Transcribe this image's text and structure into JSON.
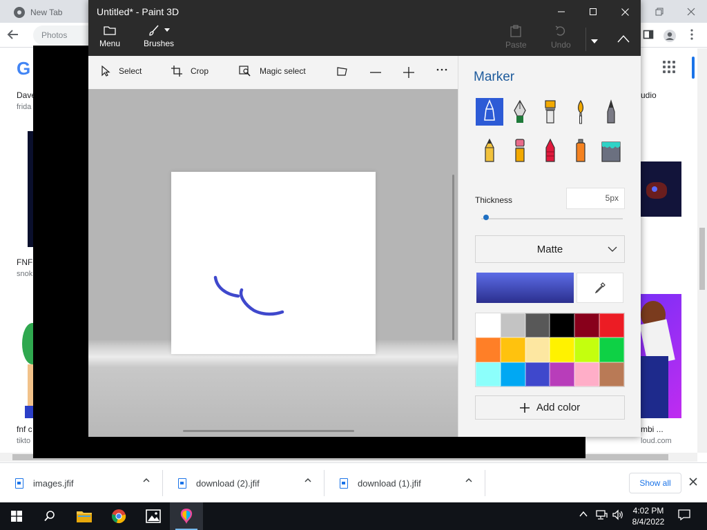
{
  "chrome": {
    "tab_title": "New Tab",
    "omnibox_text": "Photos",
    "logo_letter": "G",
    "results": {
      "left_col": [
        "Dave",
        "frida",
        "FNF",
        "snok",
        "fnf c",
        "tikto"
      ],
      "right_col": [
        "udio",
        "mbi ...",
        "loud.com"
      ]
    }
  },
  "downloads": {
    "items": [
      {
        "name": "images.jfif"
      },
      {
        "name": "download (2).jfif"
      },
      {
        "name": "download (1).jfif"
      }
    ],
    "show_all": "Show all"
  },
  "taskbar": {
    "time": "4:02 PM",
    "date": "8/4/2022",
    "icons": [
      "start-icon",
      "search-icon",
      "file-explorer-icon",
      "chrome-icon",
      "photos-icon",
      "paint-3d-icon"
    ]
  },
  "paint3d": {
    "title": "Untitled* - Paint 3D",
    "ribbon": {
      "menu": "Menu",
      "brushes": "Brushes",
      "paste": "Paste",
      "undo": "Undo"
    },
    "toolbar": {
      "select": "Select",
      "crop": "Crop",
      "magic_select": "Magic select"
    },
    "panel": {
      "title": "Marker",
      "thickness_label": "Thickness",
      "thickness_value": "5px",
      "thickness_fraction": 0.02,
      "finish": "Matte",
      "add_color": "Add color",
      "current_color": "#3f48cc",
      "brushes": [
        "marker-icon",
        "calligraphy-pen-icon",
        "oil-brush-icon",
        "watercolor-icon",
        "pixel-pen-icon",
        "pencil-icon",
        "eraser-icon",
        "crayon-icon",
        "spray-can-icon",
        "fill-icon"
      ],
      "palette": [
        "#ffffff",
        "#c3c3c3",
        "#585858",
        "#000000",
        "#88001b",
        "#ec1c24",
        "#ff7f27",
        "#ffc20e",
        "#fde7a1",
        "#fff200",
        "#c4ff0e",
        "#0ed145",
        "#8cfffb",
        "#00a8f3",
        "#3f48cc",
        "#b83dba",
        "#ffaec8",
        "#b97a56"
      ]
    }
  }
}
